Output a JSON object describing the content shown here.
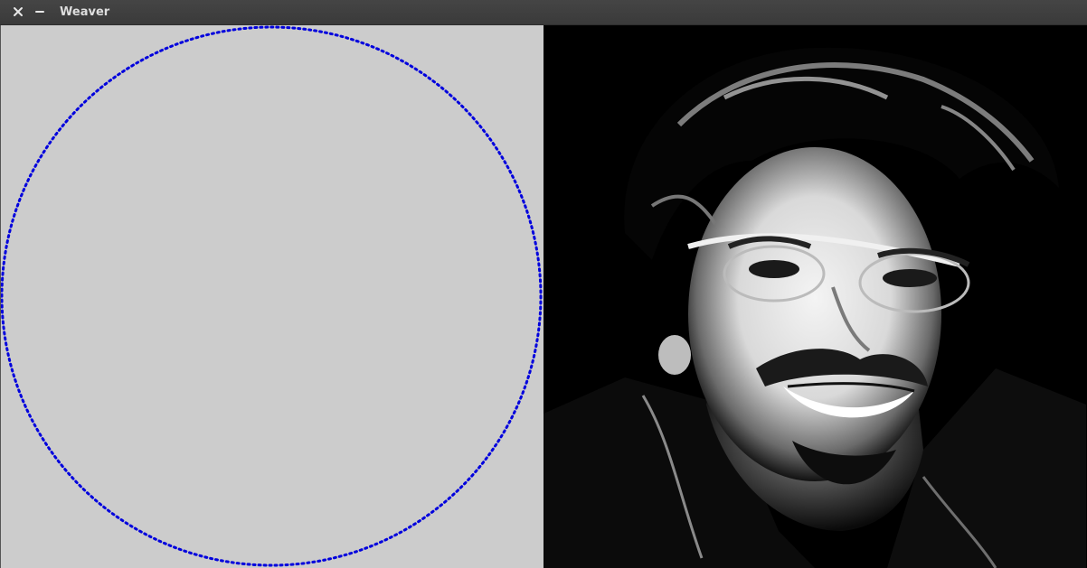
{
  "window": {
    "title": "Weaver",
    "close_icon": "close-icon",
    "minimize_icon": "minimize-icon"
  },
  "canvas": {
    "background": "#cccccc",
    "circle_color": "#0000dd",
    "circle_style": "dotted"
  },
  "photo": {
    "description_icon": "portrait-photo",
    "tone": "grayscale"
  }
}
